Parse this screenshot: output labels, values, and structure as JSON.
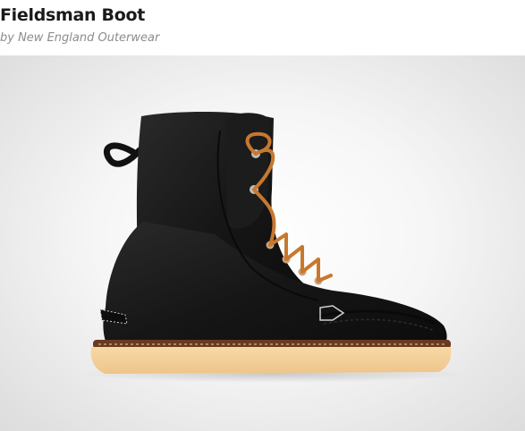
{
  "product": {
    "title": "Fieldsman Boot",
    "byline": "by New England Outerwear",
    "image_subject": "black leather boot with tan laces and crepe sole",
    "colors": {
      "title": "#1a1a1a",
      "byline": "#8c8c8c",
      "leather": "#151515",
      "lace": "#c7782f",
      "sole": "#f3cf98"
    }
  }
}
